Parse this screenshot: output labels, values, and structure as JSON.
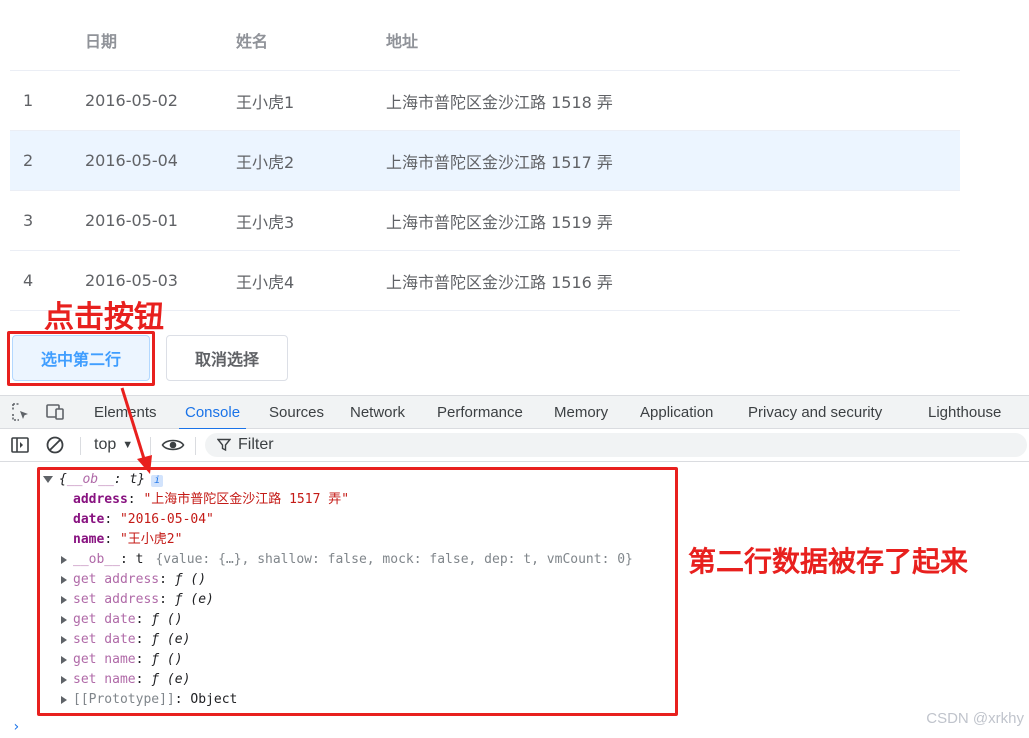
{
  "table": {
    "headers": [
      "",
      "日期",
      "姓名",
      "地址"
    ],
    "rows": [
      {
        "index": "1",
        "date": "2016-05-02",
        "name": "王小虎1",
        "address": "上海市普陀区金沙江路 1518 弄"
      },
      {
        "index": "2",
        "date": "2016-05-04",
        "name": "王小虎2",
        "address": "上海市普陀区金沙江路 1517 弄"
      },
      {
        "index": "3",
        "date": "2016-05-01",
        "name": "王小虎3",
        "address": "上海市普陀区金沙江路 1519 弄"
      },
      {
        "index": "4",
        "date": "2016-05-03",
        "name": "王小虎4",
        "address": "上海市普陀区金沙江路 1516 弄"
      }
    ],
    "selected_row_index": 1
  },
  "buttons": {
    "select_second": "选中第二行",
    "clear_selection": "取消选择"
  },
  "annotations": {
    "click_button": "点击按钮",
    "row_saved": "第二行数据被存了起来",
    "color": "#e8201e"
  },
  "devtools": {
    "tabs": [
      "Elements",
      "Console",
      "Sources",
      "Network",
      "Performance",
      "Memory",
      "Application",
      "Privacy and security",
      "Lighthouse"
    ],
    "active_tab": "Console",
    "context": "top",
    "filter_placeholder": "Filter",
    "icons": [
      "inspect-icon",
      "device-toggle-icon",
      "sidebar-toggle-icon",
      "clear-console-icon",
      "eye-icon",
      "filter-icon"
    ]
  },
  "console": {
    "summary_key": "__ob__",
    "summary_val": "t",
    "info": "i",
    "address_key": "address",
    "address_val": "\"上海市普陀区金沙江路 1517 弄\"",
    "date_key": "date",
    "date_val": "\"2016-05-04\"",
    "name_key": "name",
    "name_val": "\"王小虎2\"",
    "ob_key": "__ob__",
    "ob_val_head": "t",
    "ob_val_body": "{value: {…}, shallow: false, mock: false, dep: t, vmCount: 0}",
    "get_address": "get address",
    "set_address": "set address",
    "get_date": "get date",
    "set_date": "set date",
    "get_name": "get name",
    "set_name": "set name",
    "getter_sig": "ƒ ()",
    "setter_sig": "ƒ (e)",
    "prototype_key": "[[Prototype]]",
    "prototype_val": "Object",
    "prompt": "›"
  },
  "watermark": "CSDN @xrkhy",
  "colors": {
    "primary": "#409eff",
    "selected_row": "#ecf5ff",
    "devtools_blue": "#1a73e8"
  }
}
